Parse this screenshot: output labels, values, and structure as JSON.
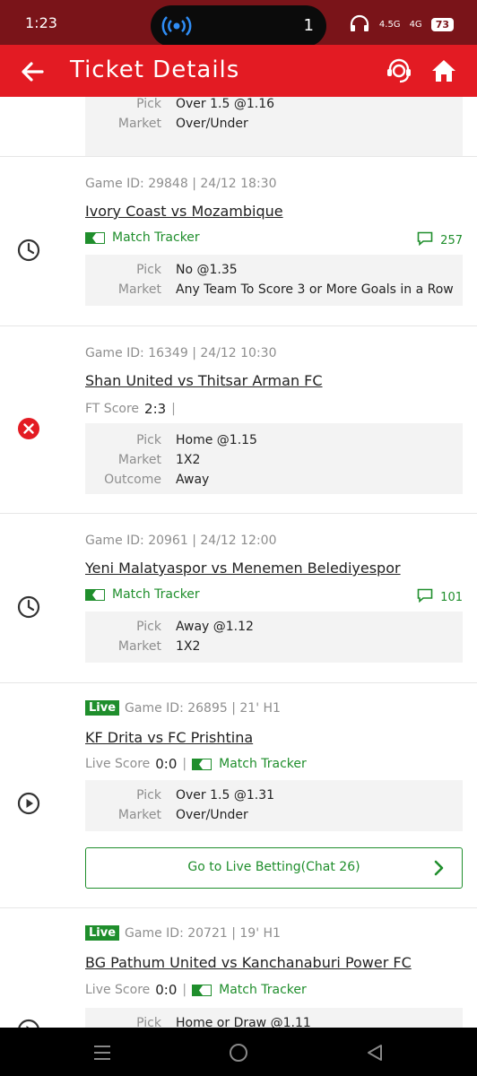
{
  "status_bar": {
    "time": "1:23",
    "island_count": "1",
    "net1": "4.5G",
    "net2": "4G",
    "battery": "73"
  },
  "app_bar": {
    "title": "Ticket Details"
  },
  "tickets": [
    {
      "rows": [
        {
          "label": "Pick",
          "value": "Over 1.5 @1.16"
        },
        {
          "label": "Market",
          "value": "Over/Under"
        }
      ]
    },
    {
      "meta": "Game ID: 29848 | 24/12 18:30",
      "match": "Ivory Coast vs Mozambique",
      "tracker": "Match Tracker",
      "comments": "257",
      "rows": [
        {
          "label": "Pick",
          "value": "No @1.35"
        },
        {
          "label": "Market",
          "value": "Any Team To Score 3 or More Goals in a Row"
        }
      ]
    },
    {
      "meta": "Game ID: 16349 | 24/12 10:30",
      "match": "Shan United vs Thitsar Arman FC",
      "score_label": "FT Score",
      "score": "2:3",
      "rows": [
        {
          "label": "Pick",
          "value": "Home @1.15"
        },
        {
          "label": "Market",
          "value": "1X2"
        },
        {
          "label": "Outcome",
          "value": "Away"
        }
      ]
    },
    {
      "meta": "Game ID: 20961 | 24/12 12:00",
      "match": "Yeni Malatyaspor vs Menemen Belediyespor",
      "tracker": "Match Tracker",
      "comments": "101",
      "rows": [
        {
          "label": "Pick",
          "value": "Away @1.12"
        },
        {
          "label": "Market",
          "value": "1X2"
        }
      ]
    },
    {
      "live": "Live",
      "meta": "Game ID: 26895 | 21' H1",
      "match": "KF Drita vs FC Prishtina",
      "score_label": "Live Score",
      "score": "0:0",
      "tracker": "Match Tracker",
      "rows": [
        {
          "label": "Pick",
          "value": "Over 1.5 @1.31"
        },
        {
          "label": "Market",
          "value": "Over/Under"
        }
      ],
      "live_button": "Go to Live Betting(Chat 26)"
    },
    {
      "live": "Live",
      "meta": "Game ID: 20721 | 19' H1",
      "match": "BG Pathum United vs Kanchanaburi Power FC",
      "score_label": "Live Score",
      "score": "0:0",
      "tracker": "Match Tracker",
      "rows": [
        {
          "label": "Pick",
          "value": "Home or Draw @1.11"
        }
      ]
    }
  ],
  "icons": {
    "pending": "clock-icon",
    "lost": "close-circle-icon",
    "live": "play-circle-icon",
    "tracker": "tracker-flag-icon",
    "comments": "comment-icon"
  },
  "colors": {
    "status_bar": "#7a1419",
    "app_bar": "#e31b23",
    "accent_green": "#1f8e2c",
    "lost_red": "#e31b23"
  }
}
